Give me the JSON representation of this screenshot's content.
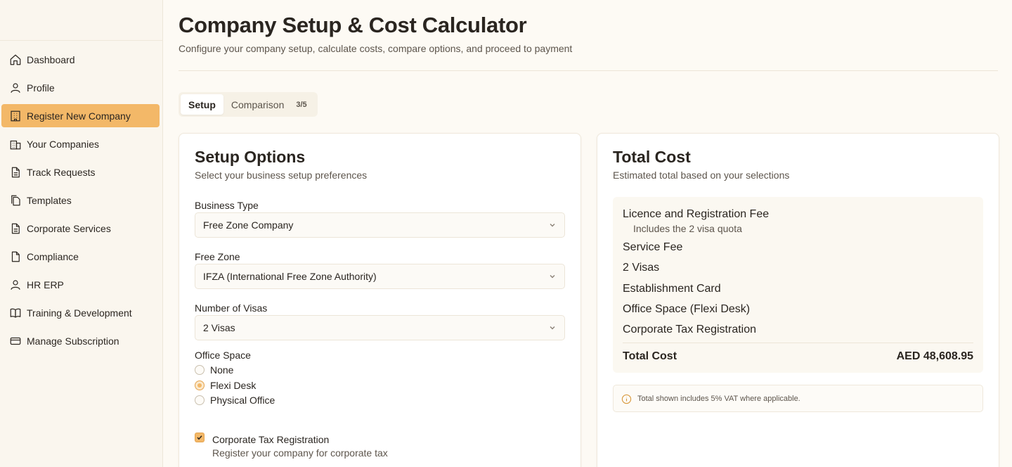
{
  "sidebar": {
    "items": [
      {
        "label": "Dashboard",
        "icon": "home-icon",
        "active": false
      },
      {
        "label": "Profile",
        "icon": "user-icon",
        "active": false
      },
      {
        "label": "Register New Company",
        "icon": "building-icon",
        "active": true
      },
      {
        "label": "Your Companies",
        "icon": "buildings-icon",
        "active": false
      },
      {
        "label": "Track Requests",
        "icon": "document-icon",
        "active": false
      },
      {
        "label": "Templates",
        "icon": "documents-icon",
        "active": false
      },
      {
        "label": "Corporate Services",
        "icon": "document-icon",
        "active": false
      },
      {
        "label": "Compliance",
        "icon": "document-icon",
        "active": false
      },
      {
        "label": "HR ERP",
        "icon": "user-icon",
        "active": false
      },
      {
        "label": "Training & Development",
        "icon": "book-icon",
        "active": false
      },
      {
        "label": "Manage Subscription",
        "icon": "credit-card-icon",
        "active": false
      }
    ]
  },
  "header": {
    "title": "Company Setup & Cost Calculator",
    "subtitle": "Configure your company setup, calculate costs, compare options, and proceed to payment"
  },
  "tabs": {
    "setup": "Setup",
    "comparison": "Comparison",
    "count": "3/5"
  },
  "setup": {
    "title": "Setup Options",
    "subtitle": "Select your business setup preferences",
    "business_type": {
      "label": "Business Type",
      "value": "Free Zone Company"
    },
    "free_zone": {
      "label": "Free Zone",
      "value": "IFZA (International Free Zone Authority)"
    },
    "visas": {
      "label": "Number of Visas",
      "value": "2 Visas"
    },
    "office_space": {
      "label": "Office Space",
      "options": [
        "None",
        "Flexi Desk",
        "Physical Office"
      ],
      "selected": "Flexi Desk"
    },
    "corporate_tax": {
      "checked": true,
      "title": "Corporate Tax Registration",
      "subtitle": "Register your company for corporate tax"
    }
  },
  "cost": {
    "title": "Total Cost",
    "subtitle": "Estimated total based on your selections",
    "lines": {
      "licence": "Licence and Registration Fee",
      "licence_note": "Includes the 2 visa quota",
      "service": "Service Fee",
      "visas": "2 Visas",
      "establishment": "Establishment Card",
      "office": "Office Space (Flexi Desk)",
      "tax": "Corporate Tax Registration"
    },
    "total_label": "Total Cost",
    "total_value": "AED 48,608.95",
    "note": "Total shown includes 5% VAT where applicable."
  },
  "colors": {
    "accent": "#f3b868",
    "background": "#fdfaf4",
    "sidebar": "#faf6ee"
  }
}
